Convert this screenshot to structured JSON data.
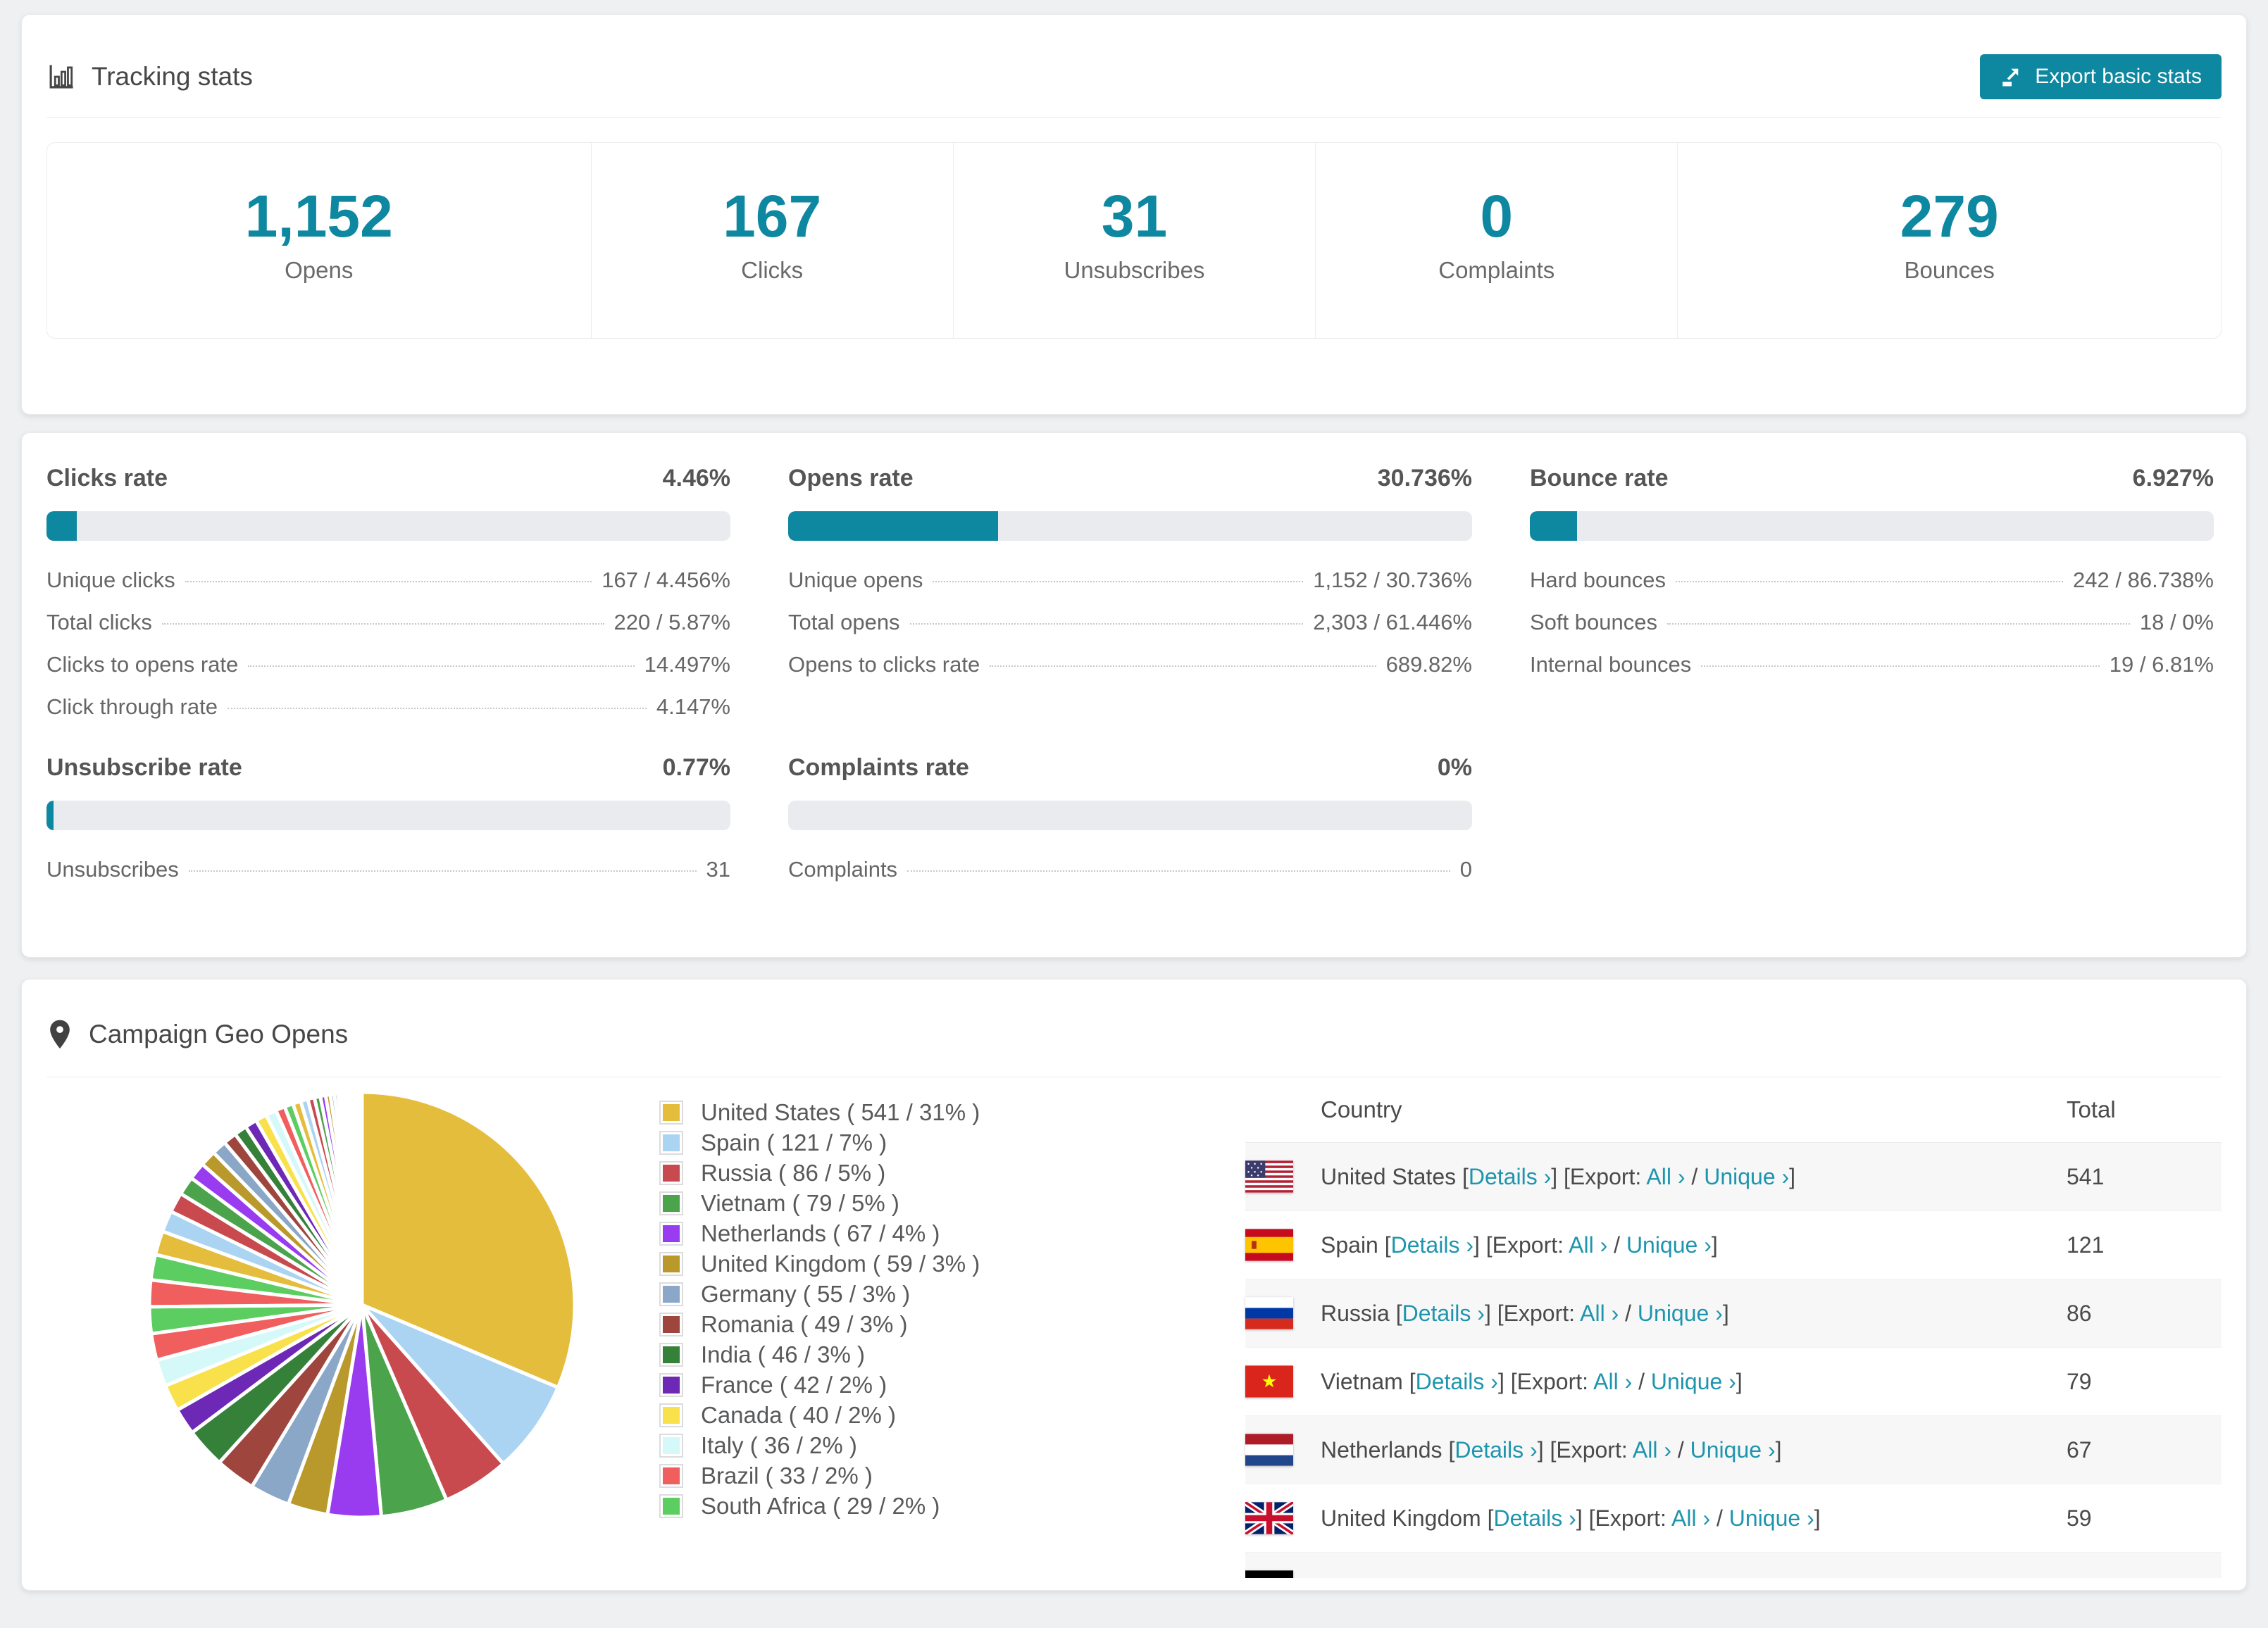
{
  "colors": {
    "accent_teal": "#0e87a0",
    "link_teal": "#1e95ad",
    "bar_track": "#e9ebee",
    "row_stripe": "#f7f7f8"
  },
  "tracking": {
    "title": "Tracking stats",
    "export_button": "Export basic stats",
    "stats": [
      {
        "value": "1,152",
        "label": "Opens"
      },
      {
        "value": "167",
        "label": "Clicks"
      },
      {
        "value": "31",
        "label": "Unsubscribes"
      },
      {
        "value": "0",
        "label": "Complaints"
      },
      {
        "value": "279",
        "label": "Bounces"
      }
    ]
  },
  "rates": {
    "row1": [
      {
        "name": "Clicks rate",
        "value": "4.46%",
        "pct": 4.46,
        "rows": [
          {
            "label": "Unique clicks",
            "value": "167 / 4.456%"
          },
          {
            "label": "Total clicks",
            "value": "220 / 5.87%"
          },
          {
            "label": "Clicks to opens rate",
            "value": "14.497%"
          },
          {
            "label": "Click through rate",
            "value": "4.147%"
          }
        ]
      },
      {
        "name": "Opens rate",
        "value": "30.736%",
        "pct": 30.736,
        "rows": [
          {
            "label": "Unique opens",
            "value": "1,152 / 30.736%"
          },
          {
            "label": "Total opens",
            "value": "2,303 / 61.446%"
          },
          {
            "label": "Opens to clicks rate",
            "value": "689.82%"
          }
        ]
      },
      {
        "name": "Bounce rate",
        "value": "6.927%",
        "pct": 6.927,
        "rows": [
          {
            "label": "Hard bounces",
            "value": "242 / 86.738%"
          },
          {
            "label": "Soft bounces",
            "value": "18 / 0%"
          },
          {
            "label": "Internal bounces",
            "value": "19 / 6.81%"
          }
        ]
      }
    ],
    "row2": [
      {
        "name": "Unsubscribe rate",
        "value": "0.77%",
        "pct": 0.77,
        "rows": [
          {
            "label": "Unsubscribes",
            "value": "31"
          }
        ]
      },
      {
        "name": "Complaints rate",
        "value": "0%",
        "pct": 0,
        "rows": [
          {
            "label": "Complaints",
            "value": "0"
          }
        ]
      }
    ]
  },
  "geo": {
    "title": "Campaign Geo Opens",
    "table": {
      "columns": [
        "Country",
        "Total"
      ],
      "links": {
        "details": "Details ›",
        "export_prefix": "[Export:",
        "all": "All ›",
        "separator": "/",
        "unique": "Unique ›"
      },
      "rows": [
        {
          "flag": "us",
          "country": "United States",
          "total": "541"
        },
        {
          "flag": "es",
          "country": "Spain",
          "total": "121"
        },
        {
          "flag": "ru",
          "country": "Russia",
          "total": "86"
        },
        {
          "flag": "vn",
          "country": "Vietnam",
          "total": "79"
        },
        {
          "flag": "nl",
          "country": "Netherlands",
          "total": "67"
        },
        {
          "flag": "gb",
          "country": "United Kingdom",
          "total": "59"
        },
        {
          "flag": "de",
          "country": "",
          "total": "",
          "partial": true
        }
      ]
    }
  },
  "chart_data": {
    "type": "pie",
    "title": "Campaign Geo Opens",
    "unit": "opens",
    "legend_position": "right-of-chart",
    "start_angle": "12 o'clock, clockwise",
    "slices": [
      {
        "label": "United States",
        "value": 541,
        "pct": 31,
        "color": "#e5bd3d",
        "legend": "United States ( 541 / 31% )"
      },
      {
        "label": "Spain",
        "value": 121,
        "pct": 7,
        "color": "#abd3f2",
        "legend": "Spain ( 121 / 7% )"
      },
      {
        "label": "Russia",
        "value": 86,
        "pct": 5,
        "color": "#c84a4e",
        "legend": "Russia ( 86 / 5% )"
      },
      {
        "label": "Vietnam",
        "value": 79,
        "pct": 5,
        "color": "#4ba34b",
        "legend": "Vietnam ( 79 / 5% )"
      },
      {
        "label": "Netherlands",
        "value": 67,
        "pct": 4,
        "color": "#993bef",
        "legend": "Netherlands ( 67 / 4% )"
      },
      {
        "label": "United Kingdom",
        "value": 59,
        "pct": 3,
        "color": "#b9992b",
        "legend": "United Kingdom ( 59 / 3% )"
      },
      {
        "label": "Germany",
        "value": 55,
        "pct": 3,
        "color": "#8ba7c7",
        "legend": "Germany ( 55 / 3% )"
      },
      {
        "label": "Romania",
        "value": 49,
        "pct": 3,
        "color": "#9e453e",
        "legend": "Romania ( 49 / 3% )"
      },
      {
        "label": "India",
        "value": 46,
        "pct": 3,
        "color": "#35813a",
        "legend": "India ( 46 / 3% )"
      },
      {
        "label": "France",
        "value": 42,
        "pct": 2,
        "color": "#6d28b5",
        "legend": "France ( 42 / 2% )"
      },
      {
        "label": "Canada",
        "value": 40,
        "pct": 2,
        "color": "#f8e14b",
        "legend": "Canada ( 40 / 2% )"
      },
      {
        "label": "Italy",
        "value": 36,
        "pct": 2,
        "color": "#d5f9f9",
        "legend": "Italy ( 36 / 2% )"
      },
      {
        "label": "Brazil",
        "value": 33,
        "pct": 2,
        "color": "#f05e5e",
        "legend": "Brazil ( 33 / 2% )"
      },
      {
        "label": "South Africa",
        "value": 29,
        "pct": 2,
        "color": "#5ccd60",
        "legend": "South Africa ( 29 / 2% )"
      }
    ],
    "others_unlabeled": {
      "note": "tail of smaller countries without legend entries, colors cycle the palette",
      "values_pct": [
        2.0,
        1.9,
        1.8,
        1.6,
        1.5,
        1.4,
        1.3,
        1.2,
        1.1,
        1.0,
        0.95,
        0.9,
        0.85,
        0.8,
        0.7,
        0.65,
        0.6,
        0.55,
        0.5,
        0.45,
        0.4,
        0.35,
        0.3,
        0.28,
        0.25,
        0.22,
        0.2,
        0.18,
        0.15,
        0.13,
        0.11,
        0.1,
        0.09,
        0.08,
        0.07,
        0.06,
        0.05,
        0.04,
        0.03,
        0.02
      ]
    }
  }
}
